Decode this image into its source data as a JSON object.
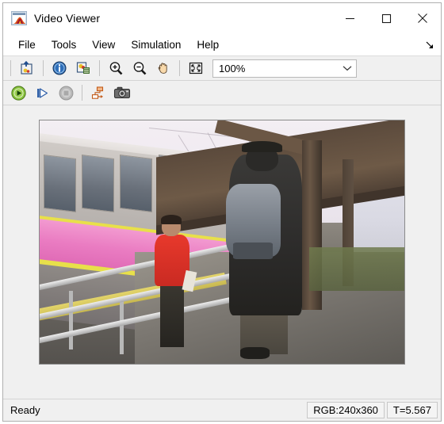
{
  "window": {
    "title": "Video Viewer",
    "app_icon": "matlab-membrane-icon",
    "controls": {
      "minimize": "minimize-icon",
      "maximize": "maximize-icon",
      "close": "close-icon"
    }
  },
  "menubar": {
    "items": [
      {
        "label": "File"
      },
      {
        "label": "Tools"
      },
      {
        "label": "View"
      },
      {
        "label": "Simulation"
      },
      {
        "label": "Help"
      }
    ],
    "overflow_icon": "undock-arrow-icon"
  },
  "toolbar_main": {
    "buttons": [
      {
        "name": "export-to-workspace",
        "icon": "export-image-icon"
      },
      {
        "name": "video-information",
        "icon": "info-icon"
      },
      {
        "name": "pixel-region",
        "icon": "image-tools-icon"
      },
      {
        "name": "zoom-in",
        "icon": "zoom-in-icon"
      },
      {
        "name": "zoom-out",
        "icon": "zoom-out-icon"
      },
      {
        "name": "pan",
        "icon": "pan-hand-icon"
      },
      {
        "name": "maintain-fit-to-window",
        "icon": "fit-to-window-icon"
      }
    ],
    "zoom_combo": {
      "value": "100%",
      "chevron_icon": "chevron-down-icon"
    }
  },
  "toolbar_playback": {
    "buttons": [
      {
        "name": "play",
        "icon": "play-icon",
        "enabled": true
      },
      {
        "name": "step-forward",
        "icon": "step-forward-icon",
        "enabled": true
      },
      {
        "name": "stop",
        "icon": "stop-icon",
        "enabled": false
      },
      {
        "name": "open-simulink-model",
        "icon": "simulink-model-icon",
        "enabled": true
      },
      {
        "name": "snapshot",
        "icon": "camera-icon",
        "enabled": true
      }
    ]
  },
  "video": {
    "description": "Train station platform: commuter train with pink and yellow stripes at left, person in red jacket walking toward camera, person with grey backpack walking away under wooden canopy",
    "colors": {
      "train_stripe": "#ea7cc2",
      "train_trim": "#e8e04a",
      "jacket": "#e8392c",
      "backpack": "#878e96",
      "canopy": "#6e5a47"
    }
  },
  "statusbar": {
    "message": "Ready",
    "format": "RGB:240x360",
    "time": "T=5.567"
  }
}
